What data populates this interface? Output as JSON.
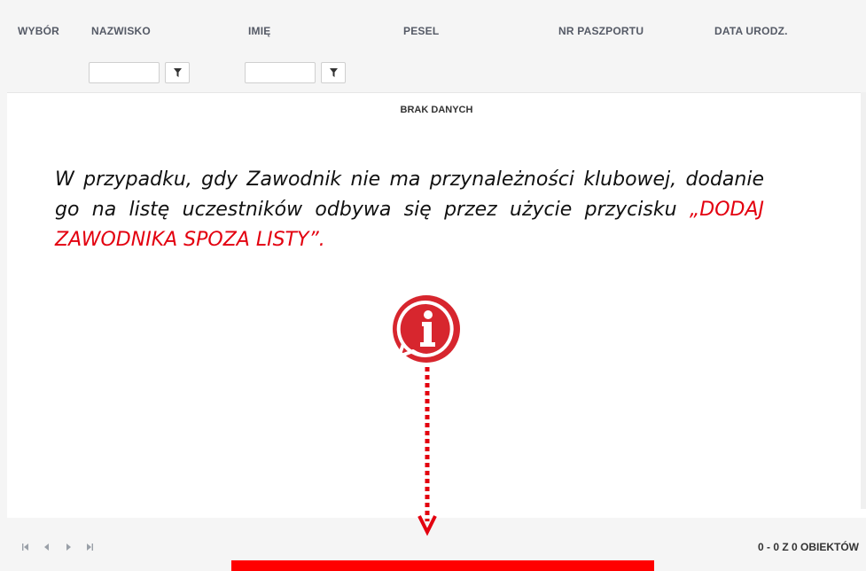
{
  "columns": {
    "wybor": "WYBÓR",
    "nazwisko": "NAZWISKO",
    "imie": "IMIĘ",
    "pesel": "PESEL",
    "nr_paszportu": "NR PASZPORTU",
    "data_urodz": "DATA URODZ."
  },
  "filters": {
    "nazwisko_value": "",
    "imie_value": "",
    "filter_icon": "filter-icon"
  },
  "grid": {
    "no_data": "BRAK DANYCH"
  },
  "note": {
    "text_before": "W przypadku, gdy Zawodnik nie ma przynależności klubowej, dodanie go na listę uczestników odbywa się przez użycie przycisku ",
    "highlight": "„DODAJ ZAWODNIKA SPOZA LISTY”.",
    "highlight_color": "#e3000f"
  },
  "info_icon": "info-icon",
  "pager": {
    "first_icon": "first-page-icon",
    "prev_icon": "previous-page-icon",
    "next_icon": "next-page-icon",
    "last_icon": "last-page-icon",
    "info": "0 - 0 Z 0 OBIEKTÓW"
  },
  "colors": {
    "accent_red": "#ff0000",
    "info_red": "#d7262e"
  }
}
